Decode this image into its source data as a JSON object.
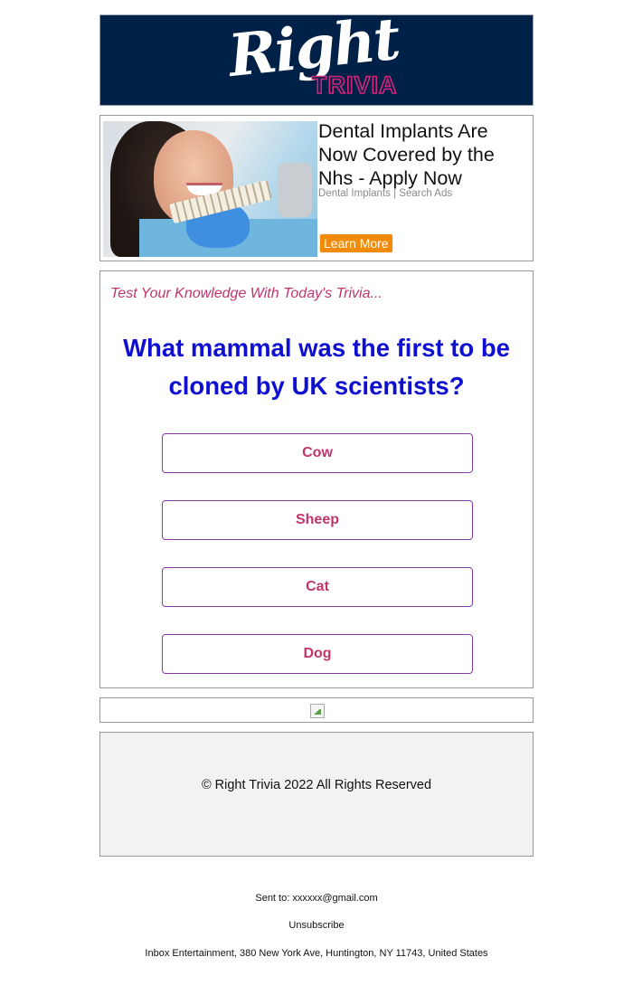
{
  "header": {
    "logo_word": "Right",
    "logo_sub": "TRIVIA",
    "colors": {
      "background": "#002147",
      "accent": "#d4247a"
    }
  },
  "ad": {
    "image_icon": "dental-patient-photo",
    "title": "Dental Implants Are Now Covered by the Nhs - Apply Now",
    "meta": "Dental Implants | Search Ads",
    "cta_label": "Learn More",
    "cta_color": "#f28b0a"
  },
  "trivia": {
    "kicker": "Test Your Knowledge With Today's Trivia...",
    "question": "What mammal was the first to be cloned by UK scientists?",
    "answers": [
      "Cow",
      "Sheep",
      "Cat",
      "Dog"
    ],
    "colors": {
      "question": "#0e0fd0",
      "answer_text": "#c0356c",
      "answer_border": "#8a3aa3"
    }
  },
  "image_strip": {
    "icon": "broken-image-icon"
  },
  "footer": {
    "copyright": "© Right Trivia 2022 All Rights Reserved",
    "sent_to_label": "Sent to: ",
    "sent_to_email": "xxxxxx@gmail.com",
    "unsubscribe": "Unsubscribe",
    "address": "Inbox Entertainment, 380 New York Ave, Huntington, NY 11743, United States"
  }
}
